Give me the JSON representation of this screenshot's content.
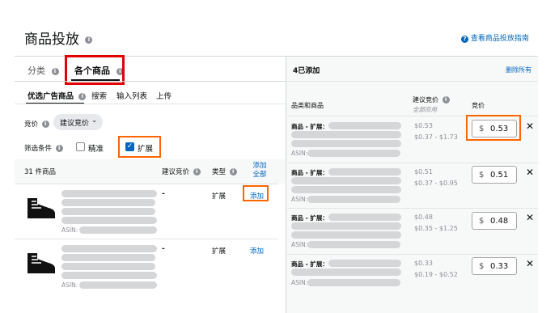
{
  "page": {
    "title": "商品投放",
    "guide_link": "查看商品投放指南"
  },
  "tabs": {
    "category": "分类",
    "individual": "各个商品"
  },
  "subtabs": [
    "优选广告商品",
    "搜索",
    "输入列表",
    "上传"
  ],
  "bid": {
    "label": "竞价",
    "dropdown": "建议竞价"
  },
  "filter": {
    "label": "筛选条件",
    "exact": "精准",
    "expanded": "扩展"
  },
  "list": {
    "count": "31 件商品",
    "col_bid": "建议竞价",
    "col_type": "类型",
    "add_all": "添加全部",
    "rows": [
      {
        "bid": "-",
        "type": "扩展",
        "action": "添加",
        "asin": "ASIN:"
      },
      {
        "bid": "-",
        "type": "扩展",
        "action": "添加",
        "asin": "ASIN:"
      }
    ]
  },
  "added": {
    "count": "4已添加",
    "remove_all": "删除所有",
    "col_product": "品类和商品",
    "col_suggest": "建议竞价",
    "col_suggest_sub": "全部应用",
    "col_bid": "竞价",
    "rows": [
      {
        "label": "商品 - 扩展：",
        "asin": "ASIN:",
        "suggest": "$0.53",
        "range": "$0.37 - $1.73",
        "currency": "$",
        "bid": "0.53",
        "remove": "✕"
      },
      {
        "label": "商品 - 扩展：",
        "asin": "ASIN:",
        "suggest": "$0.51",
        "range": "$0.37 - $0.95",
        "currency": "$",
        "bid": "0.51",
        "remove": "✕"
      },
      {
        "label": "商品 - 扩展：",
        "asin": "ASIN:",
        "suggest": "$0.48",
        "range": "$0.35 - $1.25",
        "currency": "$",
        "bid": "0.48",
        "remove": "✕"
      },
      {
        "label": "商品 - 扩展：",
        "asin": "ASIN:",
        "suggest": "$0.33",
        "range": "$0.19 - $0.52",
        "currency": "$",
        "bid": "0.33",
        "remove": "✕"
      }
    ]
  },
  "icons": {
    "info": "info-icon",
    "help": "question-icon",
    "boot": "boot-icon",
    "check": "checkmark-icon",
    "chevron": "chevron-down-icon"
  },
  "colors": {
    "link": "#0066c0",
    "highlight_red": "#e00000",
    "highlight_orange": "#ff6600",
    "checkbox": "#0066c0"
  }
}
